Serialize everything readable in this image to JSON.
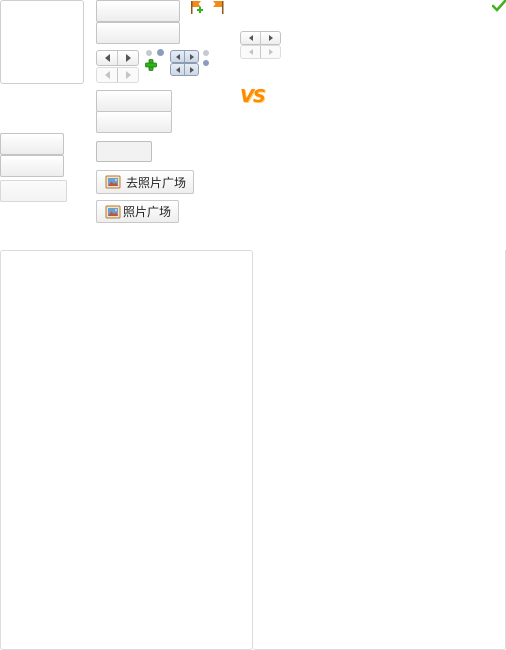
{
  "photo_square_button": {
    "label": "去照片广场"
  },
  "photo_button": {
    "label": "照片广场"
  },
  "vs_badge": {
    "text": "VS"
  },
  "icons": {
    "add_flag": "flag-add-icon",
    "flag": "flag-icon",
    "check": "checkmark-icon",
    "plus": "plus-icon",
    "photo": "photo-icon"
  },
  "colors": {
    "vs_orange": "#ff8a00",
    "check_green": "#46b01e",
    "plus_green": "#2db31c",
    "flag_orange": "#f08a1c",
    "dot_blue": "#8a9cc0",
    "dot_grey": "#c4c9d2"
  }
}
